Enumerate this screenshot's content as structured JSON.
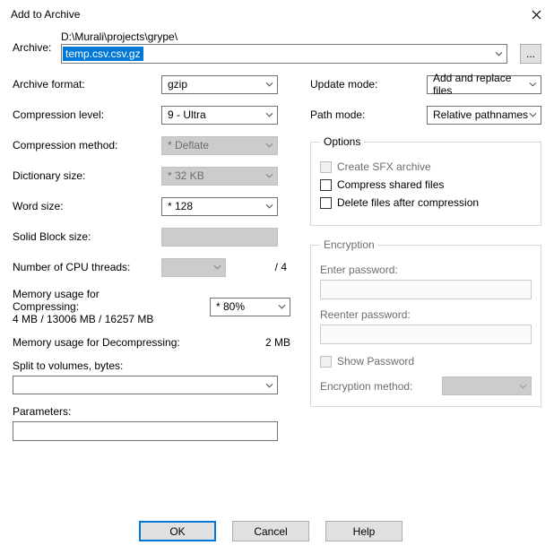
{
  "title": "Add to Archive",
  "archive": {
    "label": "Archive:",
    "path": "D:\\Murali\\projects\\grype\\",
    "filename": "temp.csv.csv.gz",
    "browse": "..."
  },
  "left": {
    "archive_format": {
      "label": "Archive format:",
      "value": "gzip"
    },
    "compression_level": {
      "label": "Compression level:",
      "value": "9 - Ultra"
    },
    "compression_method": {
      "label": "Compression method:",
      "value": "* Deflate"
    },
    "dictionary_size": {
      "label": "Dictionary size:",
      "value": "* 32 KB"
    },
    "word_size": {
      "label": "Word size:",
      "value": "* 128"
    },
    "solid_block_size": {
      "label": "Solid Block size:",
      "value": ""
    },
    "cpu_threads": {
      "label": "Number of CPU threads:",
      "value": "",
      "total": "/ 4"
    },
    "mem_compress": {
      "label": "Memory usage for Compressing:",
      "sub": "4 MB / 13006 MB / 16257 MB",
      "value": "* 80%"
    },
    "mem_decompress": {
      "label": "Memory usage for Decompressing:",
      "value": "2 MB"
    },
    "split": {
      "label": "Split to volumes, bytes:",
      "value": ""
    },
    "parameters": {
      "label": "Parameters:",
      "value": ""
    }
  },
  "right": {
    "update_mode": {
      "label": "Update mode:",
      "value": "Add and replace files"
    },
    "path_mode": {
      "label": "Path mode:",
      "value": "Relative pathnames"
    },
    "options": {
      "legend": "Options",
      "sfx": "Create SFX archive",
      "shared": "Compress shared files",
      "delete_after": "Delete files after compression"
    },
    "encryption": {
      "legend": "Encryption",
      "enter": "Enter password:",
      "reenter": "Reenter password:",
      "show": "Show Password",
      "method": "Encryption method:"
    }
  },
  "buttons": {
    "ok": "OK",
    "cancel": "Cancel",
    "help": "Help"
  }
}
